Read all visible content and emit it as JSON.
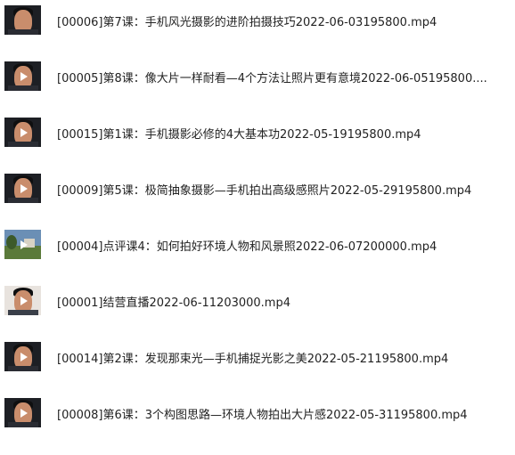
{
  "files": [
    {
      "name": "[00006]第7课：手机风光摄影的进阶拍摄技巧2022-06-03195800.mp4",
      "thumb": "portrait-dark",
      "icon": "video-thumbnail"
    },
    {
      "name": "[00005]第8课：像大片一样耐看—4个方法让照片更有意境2022-06-05195800....",
      "thumb": "portrait-dark",
      "icon": "play-icon"
    },
    {
      "name": "[00015]第1课：手机摄影必修的4大基本功2022-05-19195800.mp4",
      "thumb": "portrait-dark",
      "icon": "play-icon"
    },
    {
      "name": "[00009]第5课：极简抽象摄影—手机拍出高级感照片2022-05-29195800.mp4",
      "thumb": "portrait-dark",
      "icon": "play-icon"
    },
    {
      "name": "[00004]点评课4：如何拍好环境人物和风景照2022-06-07200000.mp4",
      "thumb": "landscape",
      "icon": "play-icon"
    },
    {
      "name": "[00001]结营直播2022-06-11203000.mp4",
      "thumb": "portrait-bright",
      "icon": "play-icon"
    },
    {
      "name": "[00014]第2课：发现那束光—手机捕捉光影之美2022-05-21195800.mp4",
      "thumb": "portrait-dark",
      "icon": "play-icon"
    },
    {
      "name": "[00008]第6课：3个构图思路—环境人物拍出大片感2022-05-31195800.mp4",
      "thumb": "portrait-dark",
      "icon": "play-icon"
    }
  ]
}
